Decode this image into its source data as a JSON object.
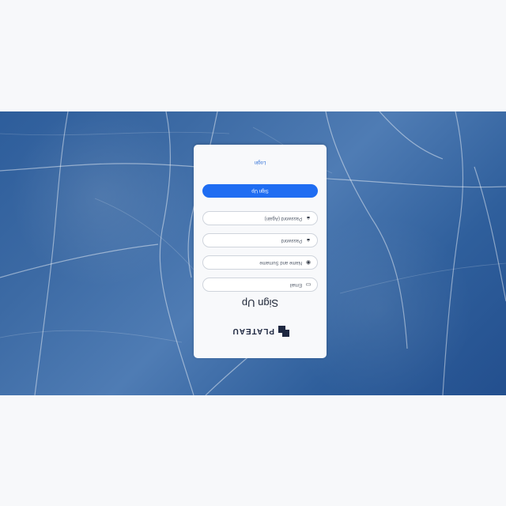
{
  "brand": {
    "name": "PLATEAU"
  },
  "auth": {
    "title": "Sign Up",
    "fields": [
      {
        "label": "Email"
      },
      {
        "label": "Name and Surname"
      },
      {
        "label": "Password"
      },
      {
        "label": "Password (Again)"
      }
    ],
    "primary_button": "Sign Up",
    "secondary_link": "Login"
  },
  "icons": {
    "logo": "plateau-logo-icon",
    "email": "id-card-icon",
    "name": "user-circle-icon",
    "password": "lock-icon",
    "password_again": "lock-icon"
  },
  "colors": {
    "primary": "#1f6df2",
    "link": "#2f6fd7",
    "card": "#f8f9fb",
    "background": "#f7f8fa",
    "ice": "#3c6aa4"
  }
}
